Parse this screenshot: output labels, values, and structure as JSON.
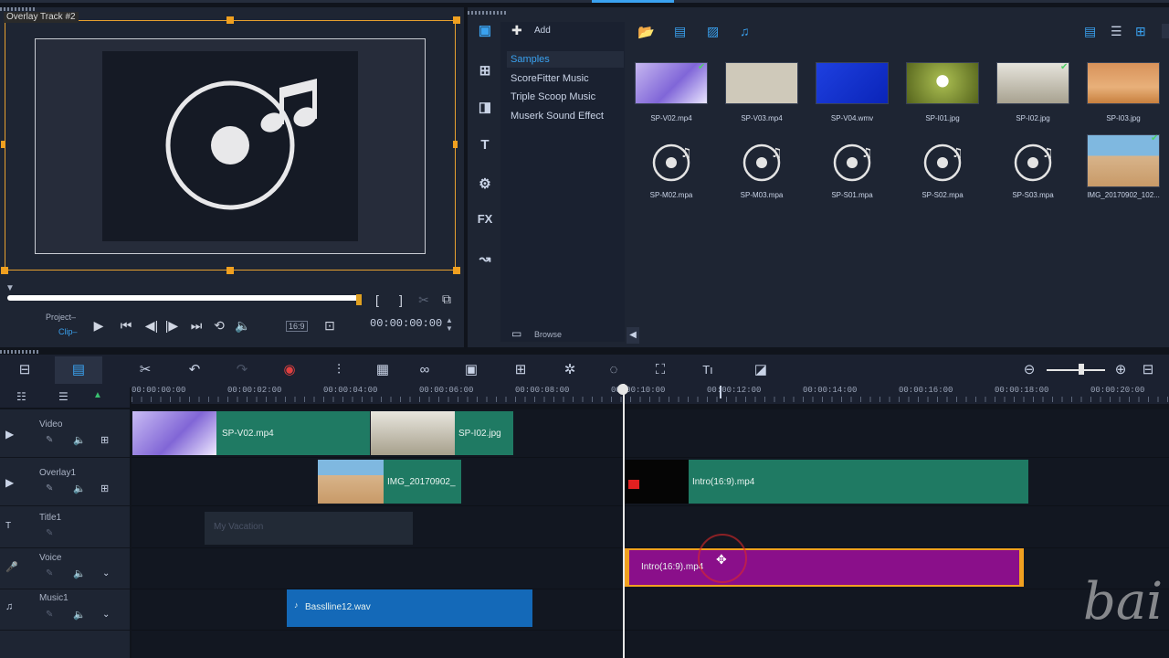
{
  "colors": {
    "accent": "#3aa2f0",
    "video_clip": "#1f7a63",
    "voice_clip": "#8a0f8a",
    "music_clip": "#1469b8",
    "handle": "#f0a020"
  },
  "preview": {
    "overlay_label": "Overlay Track #2",
    "mode_project": "Project–",
    "mode_clip": "Clip–",
    "aspect": "16:9",
    "timecode": "00:00:00:00",
    "scrub_progress": 0.98
  },
  "library": {
    "add_label": "Add",
    "categories": [
      "Samples",
      "ScoreFitter Music",
      "Triple Scoop Music",
      "Muserk Sound Effect"
    ],
    "browse_label": "Browse",
    "media_row1": [
      "SP-V02.mp4",
      "SP-V03.mp4",
      "SP-V04.wmv",
      "SP-I01.jpg",
      "SP-I02.jpg",
      "SP-I03.jpg"
    ],
    "media_row2": [
      "SP-M02.mpa",
      "SP-M03.mpa",
      "SP-S01.mpa",
      "SP-S02.mpa",
      "SP-S03.mpa",
      "IMG_20170902_102..."
    ],
    "sidebar_icons": [
      "media-icon",
      "instant-project-icon",
      "transition-icon",
      "title-icon",
      "graphics-icon",
      "filter-icon",
      "path-icon"
    ],
    "fx_label": "FX"
  },
  "timeline": {
    "ruler": [
      "00:00:00:00",
      "00:00:02:00",
      "00:00:04:00",
      "00:00:06:00",
      "00:00:08:00",
      "00:00:10:00",
      "00:00:12:00",
      "00:00:14:00",
      "00:00:16:00",
      "00:00:18:00",
      "00:00:20:00"
    ],
    "tracks": [
      "Video",
      "Overlay1",
      "Title1",
      "Voice",
      "Music1"
    ],
    "clips": {
      "video_1": "SP-V02.mp4",
      "video_2": "SP-I02.jpg",
      "overlay_1": "IMG_20170902_",
      "overlay_2": "Intro(16:9).mp4",
      "title_1": "My Vacation",
      "voice_1": "Intro(16:9).mp4",
      "music_1": "Basslline12.wav"
    },
    "watermark": "bai"
  }
}
